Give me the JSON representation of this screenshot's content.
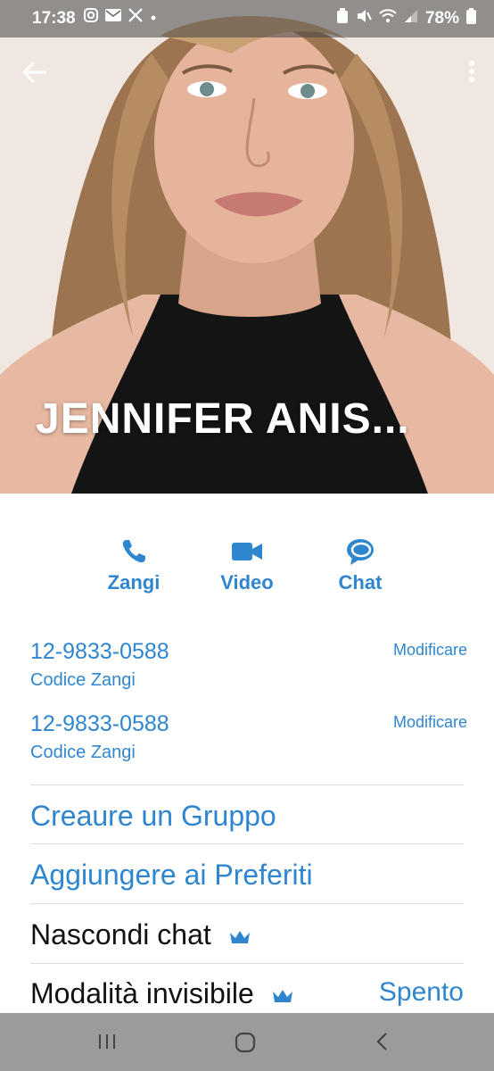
{
  "status_bar": {
    "time": "17:38",
    "battery": "78%",
    "icons": [
      "instagram-icon",
      "mail-icon",
      "x-icon",
      "dot-icon",
      "battery-saver-icon",
      "mute-icon",
      "wifi-icon",
      "signal-icon",
      "battery-icon"
    ]
  },
  "contact": {
    "name": "JENNIFER  ANIS..."
  },
  "actions": {
    "call": "Zangi",
    "video": "Video",
    "chat": "Chat"
  },
  "numbers": [
    {
      "number": "12-9833-0588",
      "label": "Codice Zangi",
      "edit": "Modificare"
    },
    {
      "number": "12-9833-0588",
      "label": "Codice Zangi",
      "edit": "Modificare"
    }
  ],
  "menu": {
    "create_group": "Creaure un Gruppo",
    "add_favorites": "Aggiungere ai Preferiti",
    "hide_chat": "Nascondi chat",
    "invisible_mode": "Modalità invisibile",
    "invisible_value": "Spento"
  },
  "colors": {
    "accent": "#2f86cf",
    "nav_bar": "#9b9b9b"
  }
}
